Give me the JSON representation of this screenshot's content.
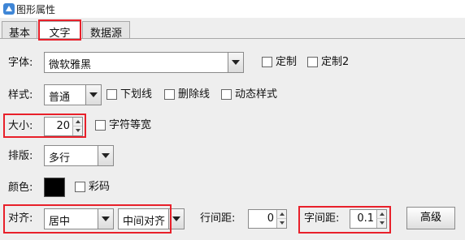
{
  "window": {
    "title": "图形属性",
    "icon": "app-icon"
  },
  "tabs": [
    {
      "label": "基本",
      "active": false
    },
    {
      "label": "文字",
      "active": true
    },
    {
      "label": "数据源",
      "active": false
    }
  ],
  "font": {
    "label": "字体:",
    "value": "微软雅黑",
    "custom_label": "定制",
    "custom2_label": "定制2"
  },
  "style": {
    "label": "样式:",
    "value": "普通",
    "underline_label": "下划线",
    "strike_label": "删除线",
    "dynamic_label": "动态样式"
  },
  "size": {
    "label": "大小:",
    "value": "20",
    "monospace_label": "字符等宽"
  },
  "layout": {
    "label": "排版:",
    "value": "多行"
  },
  "color": {
    "label": "颜色:",
    "value": "#000000",
    "colorcode_label": "彩码"
  },
  "align": {
    "label": "对齐:",
    "h_value": "居中",
    "v_value": "中间对齐",
    "line_spacing_label": "行间距:",
    "line_spacing_value": "0",
    "char_spacing_label": "字间距:",
    "char_spacing_value": "0.1",
    "advanced_label": "高级"
  },
  "highlight_color": "#e8202a"
}
